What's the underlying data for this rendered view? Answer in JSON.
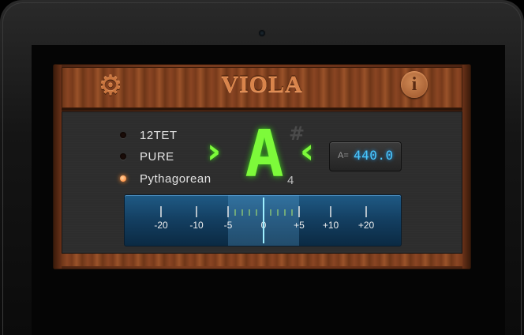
{
  "app": {
    "title": "VIOLA",
    "settings_icon": "gear-icon",
    "info_icon": "info-icon",
    "info_glyph": "i"
  },
  "temperaments": [
    {
      "label": "12TET",
      "selected": false
    },
    {
      "label": "PURE",
      "selected": false
    },
    {
      "label": "Pythagorean",
      "selected": true
    }
  ],
  "tuner": {
    "note": "A",
    "octave": "4",
    "accidental": "#",
    "left_indicator": "›",
    "right_indicator": "‹",
    "reference_label": "A=",
    "reference_value": "440.0"
  },
  "meter": {
    "ticks": [
      "-20",
      "-10",
      "-5",
      "0",
      "+5",
      "+10",
      "+20"
    ],
    "needle_cents": 0
  },
  "colors": {
    "accent_green": "#7dfa3a",
    "led_on": "#ff7a22",
    "lcd_blue": "#49c8ff",
    "wood": "#7a3d1f"
  }
}
